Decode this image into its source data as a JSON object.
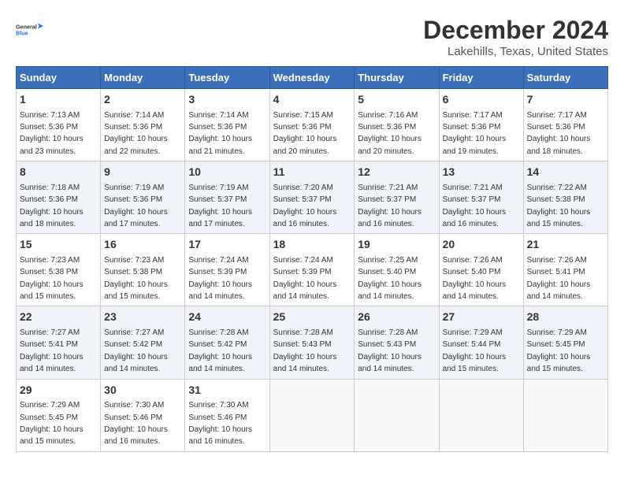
{
  "header": {
    "logo_line1": "General",
    "logo_line2": "Blue",
    "title": "December 2024",
    "subtitle": "Lakehills, Texas, United States"
  },
  "weekdays": [
    "Sunday",
    "Monday",
    "Tuesday",
    "Wednesday",
    "Thursday",
    "Friday",
    "Saturday"
  ],
  "weeks": [
    [
      {
        "day": "1",
        "info": "Sunrise: 7:13 AM\nSunset: 5:36 PM\nDaylight: 10 hours\nand 23 minutes."
      },
      {
        "day": "2",
        "info": "Sunrise: 7:14 AM\nSunset: 5:36 PM\nDaylight: 10 hours\nand 22 minutes."
      },
      {
        "day": "3",
        "info": "Sunrise: 7:14 AM\nSunset: 5:36 PM\nDaylight: 10 hours\nand 21 minutes."
      },
      {
        "day": "4",
        "info": "Sunrise: 7:15 AM\nSunset: 5:36 PM\nDaylight: 10 hours\nand 20 minutes."
      },
      {
        "day": "5",
        "info": "Sunrise: 7:16 AM\nSunset: 5:36 PM\nDaylight: 10 hours\nand 20 minutes."
      },
      {
        "day": "6",
        "info": "Sunrise: 7:17 AM\nSunset: 5:36 PM\nDaylight: 10 hours\nand 19 minutes."
      },
      {
        "day": "7",
        "info": "Sunrise: 7:17 AM\nSunset: 5:36 PM\nDaylight: 10 hours\nand 18 minutes."
      }
    ],
    [
      {
        "day": "8",
        "info": "Sunrise: 7:18 AM\nSunset: 5:36 PM\nDaylight: 10 hours\nand 18 minutes."
      },
      {
        "day": "9",
        "info": "Sunrise: 7:19 AM\nSunset: 5:36 PM\nDaylight: 10 hours\nand 17 minutes."
      },
      {
        "day": "10",
        "info": "Sunrise: 7:19 AM\nSunset: 5:37 PM\nDaylight: 10 hours\nand 17 minutes."
      },
      {
        "day": "11",
        "info": "Sunrise: 7:20 AM\nSunset: 5:37 PM\nDaylight: 10 hours\nand 16 minutes."
      },
      {
        "day": "12",
        "info": "Sunrise: 7:21 AM\nSunset: 5:37 PM\nDaylight: 10 hours\nand 16 minutes."
      },
      {
        "day": "13",
        "info": "Sunrise: 7:21 AM\nSunset: 5:37 PM\nDaylight: 10 hours\nand 16 minutes."
      },
      {
        "day": "14",
        "info": "Sunrise: 7:22 AM\nSunset: 5:38 PM\nDaylight: 10 hours\nand 15 minutes."
      }
    ],
    [
      {
        "day": "15",
        "info": "Sunrise: 7:23 AM\nSunset: 5:38 PM\nDaylight: 10 hours\nand 15 minutes."
      },
      {
        "day": "16",
        "info": "Sunrise: 7:23 AM\nSunset: 5:38 PM\nDaylight: 10 hours\nand 15 minutes."
      },
      {
        "day": "17",
        "info": "Sunrise: 7:24 AM\nSunset: 5:39 PM\nDaylight: 10 hours\nand 14 minutes."
      },
      {
        "day": "18",
        "info": "Sunrise: 7:24 AM\nSunset: 5:39 PM\nDaylight: 10 hours\nand 14 minutes."
      },
      {
        "day": "19",
        "info": "Sunrise: 7:25 AM\nSunset: 5:40 PM\nDaylight: 10 hours\nand 14 minutes."
      },
      {
        "day": "20",
        "info": "Sunrise: 7:26 AM\nSunset: 5:40 PM\nDaylight: 10 hours\nand 14 minutes."
      },
      {
        "day": "21",
        "info": "Sunrise: 7:26 AM\nSunset: 5:41 PM\nDaylight: 10 hours\nand 14 minutes."
      }
    ],
    [
      {
        "day": "22",
        "info": "Sunrise: 7:27 AM\nSunset: 5:41 PM\nDaylight: 10 hours\nand 14 minutes."
      },
      {
        "day": "23",
        "info": "Sunrise: 7:27 AM\nSunset: 5:42 PM\nDaylight: 10 hours\nand 14 minutes."
      },
      {
        "day": "24",
        "info": "Sunrise: 7:28 AM\nSunset: 5:42 PM\nDaylight: 10 hours\nand 14 minutes."
      },
      {
        "day": "25",
        "info": "Sunrise: 7:28 AM\nSunset: 5:43 PM\nDaylight: 10 hours\nand 14 minutes."
      },
      {
        "day": "26",
        "info": "Sunrise: 7:28 AM\nSunset: 5:43 PM\nDaylight: 10 hours\nand 14 minutes."
      },
      {
        "day": "27",
        "info": "Sunrise: 7:29 AM\nSunset: 5:44 PM\nDaylight: 10 hours\nand 15 minutes."
      },
      {
        "day": "28",
        "info": "Sunrise: 7:29 AM\nSunset: 5:45 PM\nDaylight: 10 hours\nand 15 minutes."
      }
    ],
    [
      {
        "day": "29",
        "info": "Sunrise: 7:29 AM\nSunset: 5:45 PM\nDaylight: 10 hours\nand 15 minutes."
      },
      {
        "day": "30",
        "info": "Sunrise: 7:30 AM\nSunset: 5:46 PM\nDaylight: 10 hours\nand 16 minutes."
      },
      {
        "day": "31",
        "info": "Sunrise: 7:30 AM\nSunset: 5:46 PM\nDaylight: 10 hours\nand 16 minutes."
      },
      {
        "day": "",
        "info": ""
      },
      {
        "day": "",
        "info": ""
      },
      {
        "day": "",
        "info": ""
      },
      {
        "day": "",
        "info": ""
      }
    ]
  ]
}
